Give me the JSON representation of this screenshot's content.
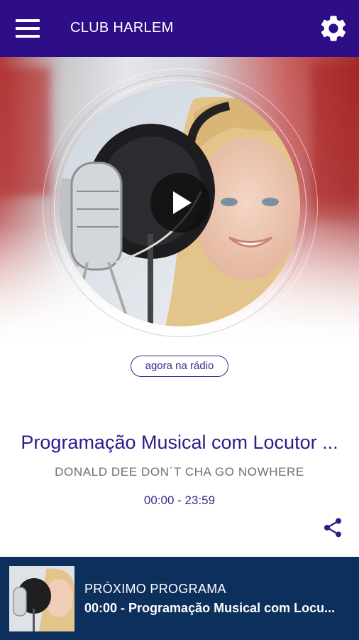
{
  "appbar": {
    "title": "CLUB HARLEM",
    "menu_icon": "menu-icon",
    "settings_icon": "gear-icon",
    "background": "#2e0e87"
  },
  "player": {
    "play_icon": "play-icon",
    "badge": "agora na rádio"
  },
  "now_playing": {
    "program": "Programação Musical com Locutor ...",
    "artist": "DONALD DEE DON´T CHA GO NOWHERE",
    "time": "00:00 - 23:59",
    "share_icon": "share-icon"
  },
  "footer": {
    "label": "PRÓXIMO PROGRAMA",
    "next": "00:00 - Programação Musical com Locu...",
    "background": "#0d2f5c"
  }
}
